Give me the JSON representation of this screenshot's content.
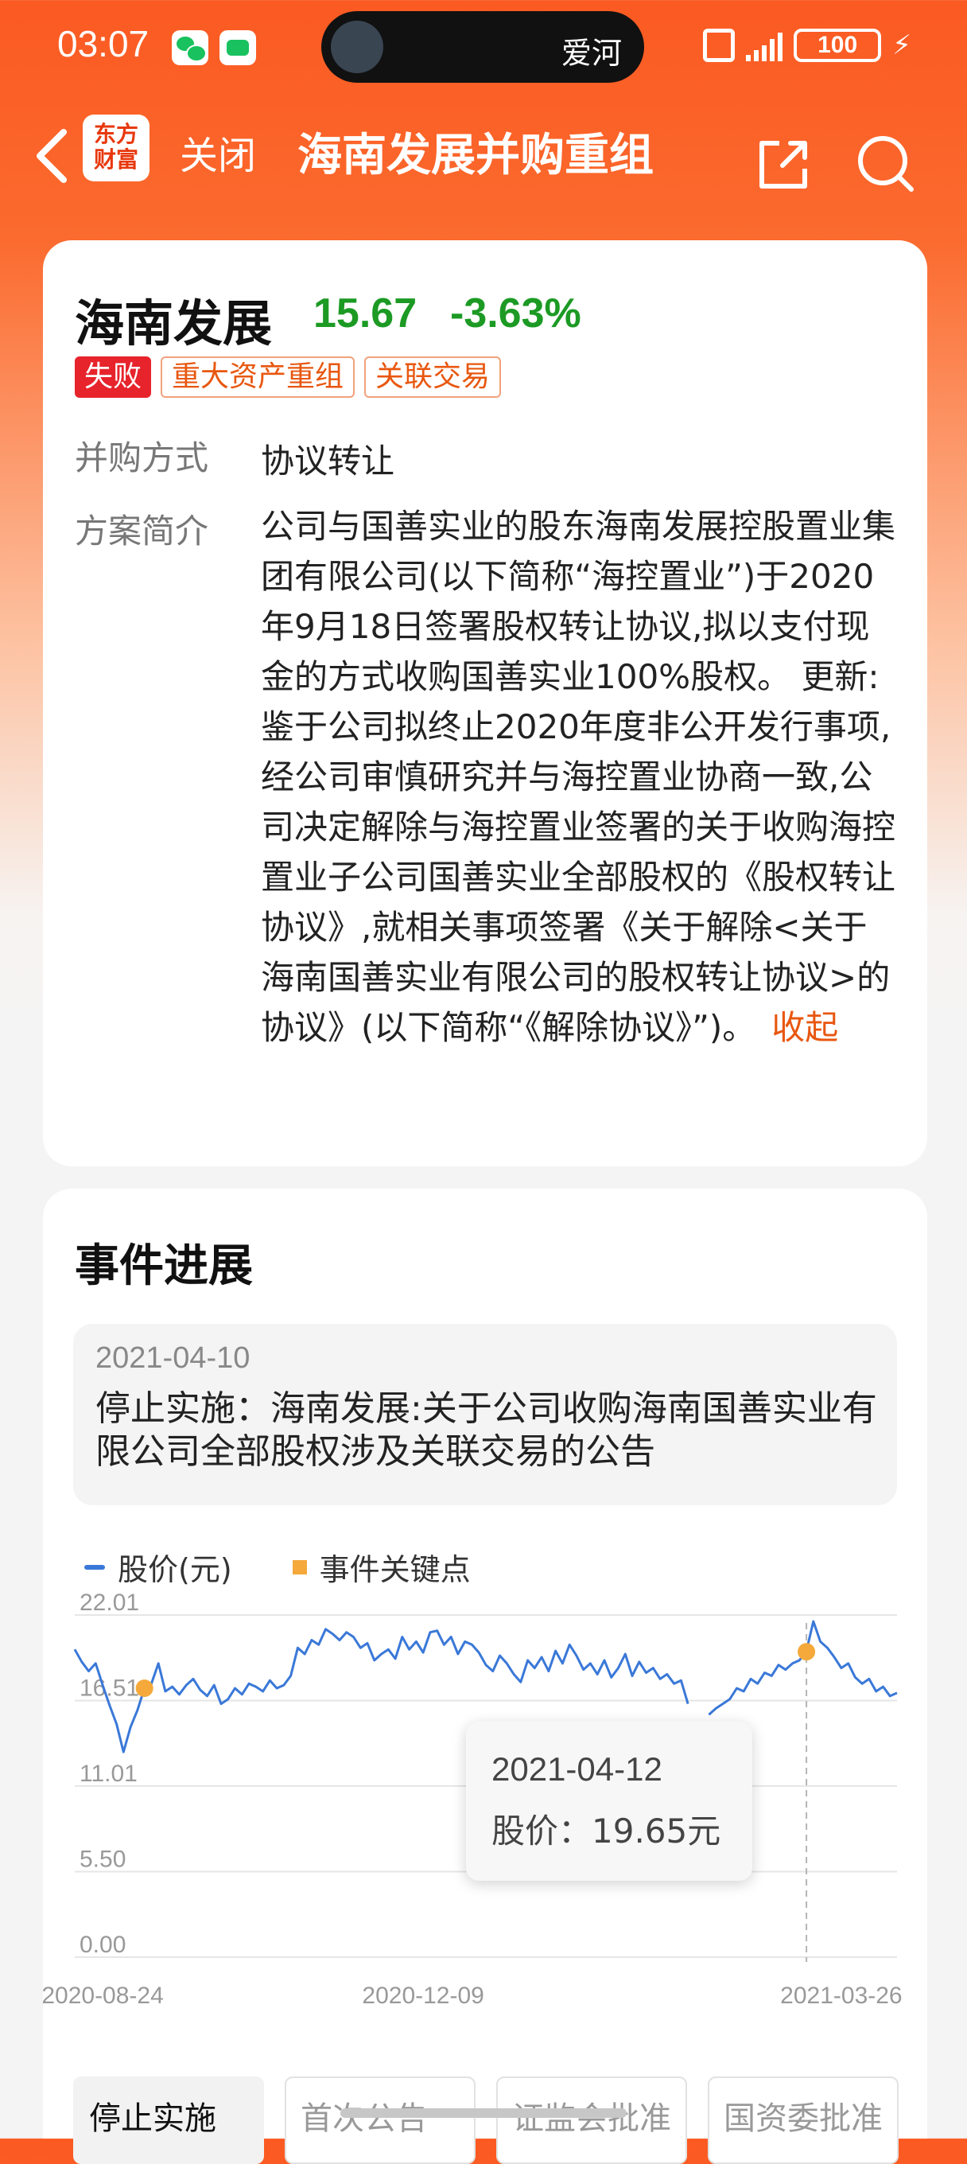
{
  "status_bar": {
    "time": "03:07",
    "now_playing": "爱河",
    "battery": "100"
  },
  "nav": {
    "logo_line1": "东方",
    "logo_line2": "财富",
    "close_label": "关闭",
    "title": "海南发展并购重组"
  },
  "stock": {
    "name": "海南发展",
    "price": "15.67",
    "change": "-3.63%",
    "tags": [
      "失败",
      "重大资产重组",
      "关联交易"
    ],
    "method_label": "并购方式",
    "method_value": "协议转让",
    "summary_label": "方案简介",
    "summary_text": "公司与国善实业的股东海南发展控股置业集团有限公司(以下简称“海控置业”)于2020年9月18日签署股权转让协议,拟以支付现金的方式收购国善实业100%股权。 更新:鉴于公司拟终止2020年度非公开发行事项,经公司审慎研究并与海控置业协商一致,公司决定解除与海控置业签署的关于收购海控置业子公司国善实业全部股权的《股权转让协议》,就相关事项签署《关于解除<关于海南国善实业有限公司的股权转让协议>的协议》(以下简称“《解除协议》”)。",
    "collapse_label": "收起"
  },
  "events": {
    "section_title": "事件进展",
    "latest_date": "2021-04-10",
    "latest_text": "停止实施：海南发展:关于公司收购海南国善实业有限公司全部股权涉及关联交易的公告",
    "legend_price": "股价(元)",
    "legend_event": "事件关键点",
    "tooltip_date": "2021-04-12",
    "tooltip_price": "股价：19.65元",
    "stages": [
      "停止实施",
      "首次公告",
      "证监会批准",
      "国资委批准"
    ]
  },
  "colors": {
    "accent": "#fb5a22",
    "up_down_green": "#1c9a24",
    "line": "#3a78d8",
    "event_marker": "#f4a93a",
    "tag_red": "#e7232b"
  },
  "chart_data": {
    "type": "line",
    "xlabel": "",
    "ylabel": "",
    "ylim": [
      0,
      22.01
    ],
    "yticks": [
      "22.01",
      "16.51",
      "11.01",
      "5.50",
      "0.00"
    ],
    "xticks": [
      "2020-08-24",
      "2020-12-09",
      "2021-03-26"
    ],
    "xtick_positions": [
      4,
      50,
      110
    ],
    "series": [
      {
        "name": "股价(元)",
        "values": [
          19.8,
          19.0,
          18.4,
          18.9,
          17.5,
          16.2,
          15.0,
          13.2,
          14.8,
          15.9,
          17.3,
          17.6,
          18.9,
          17.1,
          17.4,
          16.9,
          17.5,
          17.9,
          17.2,
          16.8,
          17.5,
          16.3,
          16.6,
          17.3,
          16.9,
          17.6,
          17.4,
          17.1,
          17.8,
          17.3,
          17.5,
          18.1,
          19.9,
          19.5,
          20.4,
          20.1,
          21.1,
          20.8,
          20.4,
          20.9,
          20.6,
          19.9,
          20.2,
          19.1,
          19.5,
          19.8,
          19.2,
          20.6,
          19.8,
          20.3,
          19.6,
          20.9,
          21.0,
          20.1,
          20.6,
          19.5,
          20.3,
          20.1,
          19.6,
          18.8,
          18.4,
          19.4,
          18.9,
          18.2,
          17.7,
          19.1,
          18.6,
          19.3,
          18.4,
          19.7,
          18.9,
          20.1,
          19.4,
          18.5,
          18.9,
          18.2,
          19.1,
          18.0,
          18.6,
          19.5,
          18.1,
          19.0,
          18.3,
          18.6,
          17.9,
          18.2,
          17.6,
          17.8,
          16.3,
          15.2,
          15.9,
          15.6,
          16.0,
          16.3,
          16.6,
          17.3,
          17.1,
          17.9,
          17.6,
          18.3,
          18.1,
          18.8,
          18.5,
          18.9,
          19.1,
          19.7,
          21.6,
          20.3,
          19.9,
          19.3,
          18.6,
          18.9,
          18.0,
          17.6,
          17.9,
          17.1,
          17.4,
          16.8,
          17.0
        ],
        "gap": [
          89,
          90
        ]
      }
    ],
    "events": [
      {
        "index": 10,
        "value": 17.3
      },
      {
        "index": 105,
        "value": 19.65
      }
    ],
    "highlight_index": 105
  }
}
